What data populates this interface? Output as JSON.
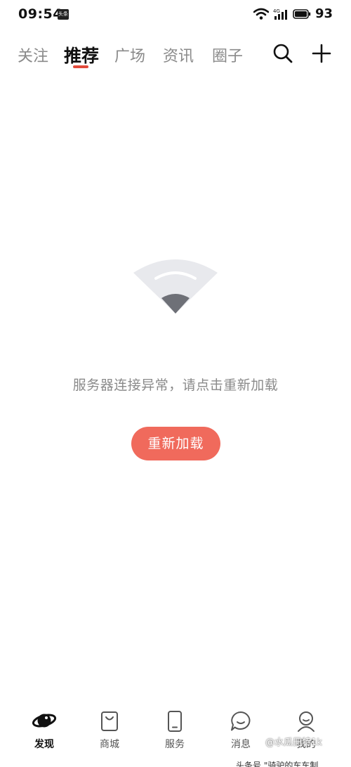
{
  "status_bar": {
    "time": "09:54",
    "badge": "头条",
    "network": "4G",
    "battery": "93"
  },
  "top_nav": {
    "tabs": [
      {
        "label": "关注",
        "active": false
      },
      {
        "label": "推荐",
        "active": true
      },
      {
        "label": "广场",
        "active": false
      },
      {
        "label": "资讯",
        "active": false
      },
      {
        "label": "圈子",
        "active": false
      }
    ],
    "icons": [
      "search-icon",
      "plus-icon"
    ],
    "accent_color": "#e24a3b"
  },
  "error_state": {
    "icon": "wifi-error-icon",
    "message": "服务器连接异常，请点击重新加载",
    "reload_label": "重新加载",
    "button_color": "#f06a5c"
  },
  "bottom_nav": {
    "items": [
      {
        "label": "发现",
        "icon": "planet-icon",
        "active": true
      },
      {
        "label": "商城",
        "icon": "shopping-bag-icon",
        "active": false
      },
      {
        "label": "服务",
        "icon": "phone-icon",
        "active": false
      },
      {
        "label": "消息",
        "icon": "chat-bubble-icon",
        "active": false
      },
      {
        "label": "我的",
        "icon": "user-icon",
        "active": false
      }
    ]
  },
  "watermark": "@水瓜冊特1k",
  "bottom_cut_text": "头条号 \"骑驴的车车制"
}
